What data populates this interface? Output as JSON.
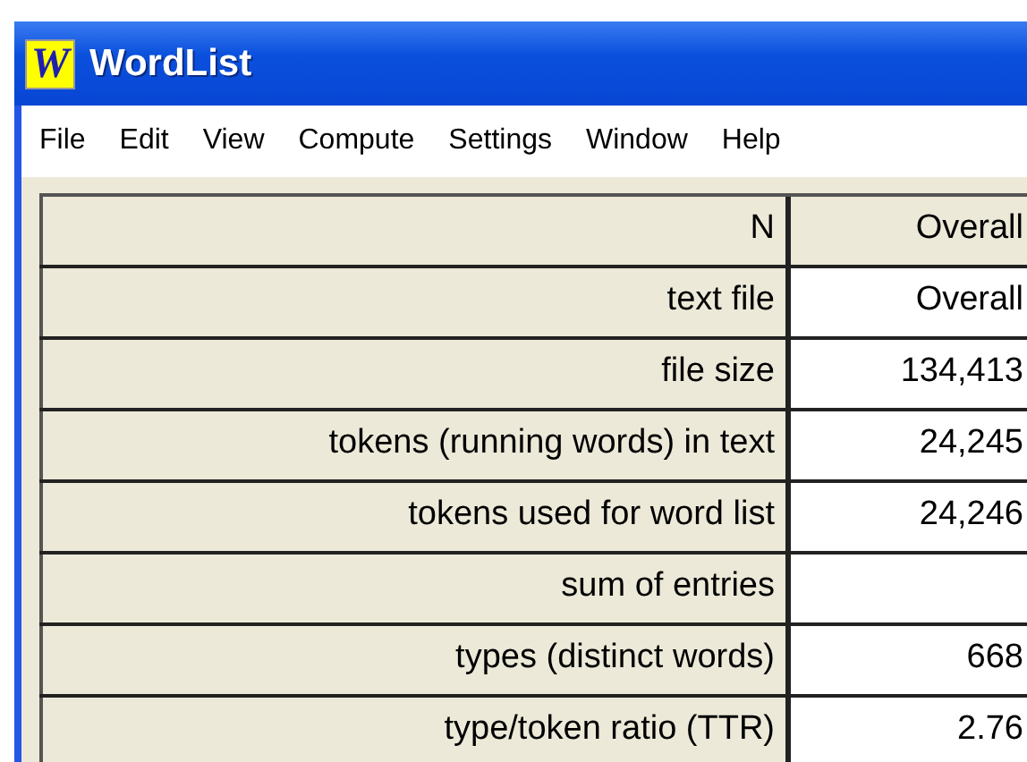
{
  "window": {
    "title": "WordList",
    "icon_letter": "W"
  },
  "menu": [
    "File",
    "Edit",
    "View",
    "Compute",
    "Settings",
    "Window",
    "Help"
  ],
  "table": {
    "header": {
      "label": "N",
      "value": "Overall"
    },
    "rows": [
      {
        "label": "text file",
        "value": "Overall"
      },
      {
        "label": "file size",
        "value": "134,413"
      },
      {
        "label": "tokens (running words) in text",
        "value": "24,245"
      },
      {
        "label": "tokens used for word list",
        "value": "24,246"
      },
      {
        "label": "sum of entries"
      },
      {
        "label": "types (distinct words)",
        "value": "668"
      },
      {
        "label": "type/token ratio (TTR)",
        "value": "2.76"
      }
    ]
  }
}
